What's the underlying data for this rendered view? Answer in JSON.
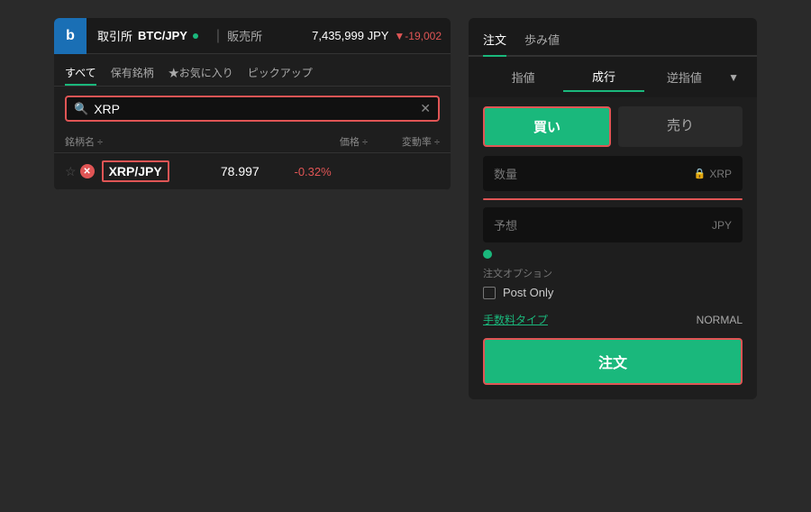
{
  "app": {
    "logo": "b",
    "header": {
      "exchange_label": "取引所",
      "pair": "BTC/JPY",
      "hanbai_label": "販売所",
      "price": "7,435,999 JPY",
      "price_change": "▼-19,002"
    }
  },
  "left_panel": {
    "tabs": [
      {
        "label": "すべて",
        "active": true
      },
      {
        "label": "保有銘柄",
        "active": false
      },
      {
        "label": "★お気に入り",
        "active": false
      },
      {
        "label": "ピックアップ",
        "active": false
      }
    ],
    "search": {
      "placeholder": "XRP",
      "value": "XRP"
    },
    "table_headers": {
      "name": "銘柄名 ÷",
      "price": "価格 ÷",
      "change": "変動率 ÷"
    },
    "rows": [
      {
        "ticker": "XRP/JPY",
        "price": "78.997",
        "change": "-0.32%"
      }
    ]
  },
  "right_panel": {
    "tabs": [
      {
        "label": "注文",
        "active": true
      },
      {
        "label": "歩み値",
        "active": false
      }
    ],
    "order_type_tabs": [
      {
        "label": "指値",
        "active": false
      },
      {
        "label": "成行",
        "active": true
      },
      {
        "label": "逆指値",
        "active": false
      }
    ],
    "dropdown_label": "▼",
    "buy_label": "買い",
    "sell_label": "売り",
    "quantity_label": "数量",
    "quantity_unit": "XRP",
    "estimate_label": "予想",
    "estimate_unit": "JPY",
    "options_title": "注文オプション",
    "post_only_label": "Post Only",
    "fee_label": "手数料タイプ",
    "fee_value": "NORMAL",
    "submit_label": "注文"
  }
}
